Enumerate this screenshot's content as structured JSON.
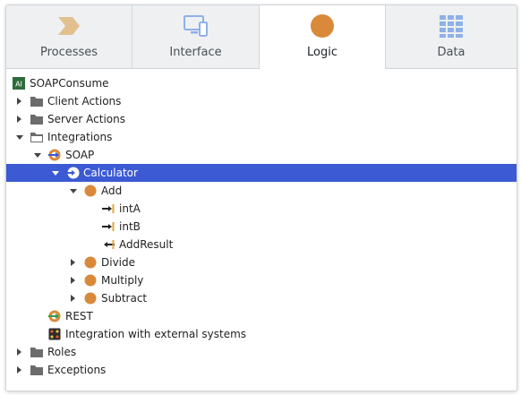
{
  "tabs": [
    {
      "label": "Processes",
      "icon": "processes-chevron-icon",
      "active": false
    },
    {
      "label": "Interface",
      "icon": "interface-devices-icon",
      "active": false
    },
    {
      "label": "Logic",
      "icon": "logic-circle-icon",
      "active": true
    },
    {
      "label": "Data",
      "icon": "data-grid-icon",
      "active": false
    }
  ],
  "tree": [
    {
      "label": "SOAPConsume",
      "icon": "app-icon",
      "arrow": "none"
    },
    {
      "label": "Client Actions",
      "icon": "folder-icon",
      "arrow": "collapsed"
    },
    {
      "label": "Server Actions",
      "icon": "folder-icon",
      "arrow": "collapsed"
    },
    {
      "label": "Integrations",
      "icon": "folder-open-icon",
      "arrow": "expanded"
    },
    {
      "label": "SOAP",
      "icon": "soap-icon",
      "arrow": "expanded"
    },
    {
      "label": "Calculator",
      "icon": "soap-service-icon",
      "arrow": "expanded",
      "selected": true
    },
    {
      "label": "Add",
      "icon": "method-icon",
      "arrow": "expanded"
    },
    {
      "label": "intA",
      "icon": "input-parameter-icon",
      "arrow": "none"
    },
    {
      "label": "intB",
      "icon": "input-parameter-icon",
      "arrow": "none"
    },
    {
      "label": "AddResult",
      "icon": "output-parameter-icon",
      "arrow": "none"
    },
    {
      "label": "Divide",
      "icon": "method-icon",
      "arrow": "collapsed"
    },
    {
      "label": "Multiply",
      "icon": "method-icon",
      "arrow": "collapsed"
    },
    {
      "label": "Subtract",
      "icon": "method-icon",
      "arrow": "collapsed"
    },
    {
      "label": "REST",
      "icon": "rest-icon",
      "arrow": "none"
    },
    {
      "label": "Integration with external systems",
      "icon": "integration-icon",
      "arrow": "none"
    },
    {
      "label": "Roles",
      "icon": "folder-icon",
      "arrow": "collapsed"
    },
    {
      "label": "Exceptions",
      "icon": "folder-icon",
      "arrow": "collapsed"
    }
  ],
  "colors": {
    "selected": "#3b5ad3",
    "accent": "#d9893a",
    "tab_icon": "#8fb0e8"
  }
}
